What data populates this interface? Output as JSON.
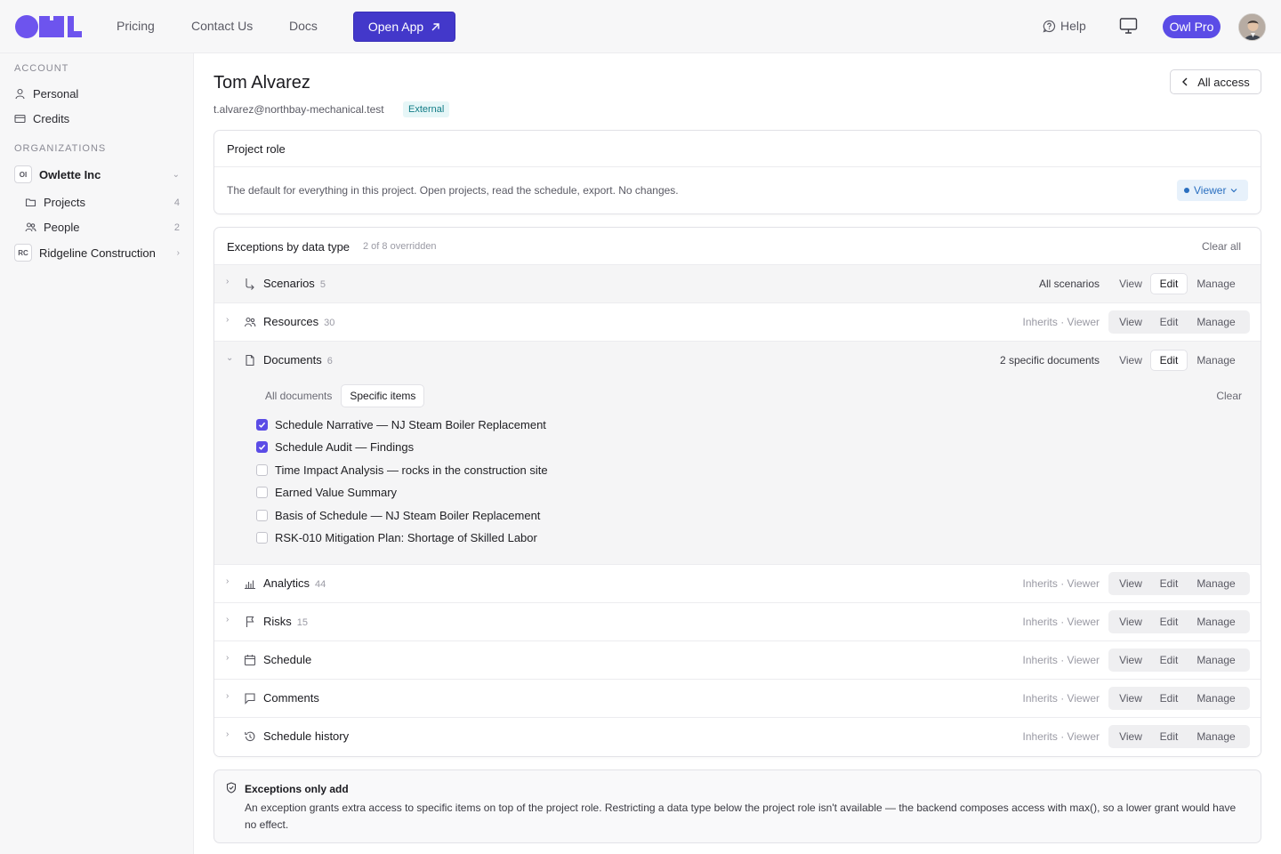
{
  "nav": {
    "links": [
      "Pricing",
      "Contact Us",
      "Docs"
    ],
    "open_app": "Open App",
    "help": "Help",
    "plan": "Owl Pro"
  },
  "sidebar": {
    "account_label": "ACCOUNT",
    "account_items": [
      "Personal",
      "Credits"
    ],
    "orgs_label": "ORGANIZATIONS",
    "org1": {
      "badge": "OI",
      "name": "Owlette Inc"
    },
    "org1_items": [
      {
        "label": "Projects",
        "count": "4"
      },
      {
        "label": "People",
        "count": "2"
      }
    ],
    "org2": {
      "badge": "RC",
      "name": "Ridgeline Construction"
    }
  },
  "user": {
    "name": "Tom Alvarez",
    "email": "t.alvarez@northbay-mechanical.test",
    "badge": "External",
    "back_button": "All access"
  },
  "project_role": {
    "title": "Project role",
    "description": "The default for everything in this project. Open projects, read the schedule, export. No changes.",
    "role": "Viewer"
  },
  "exceptions": {
    "title": "Exceptions by data type",
    "subtitle": "2 of 8 overridden",
    "clear_all": "Clear all",
    "levels": {
      "view": "View",
      "edit": "Edit",
      "manage": "Manage"
    },
    "rows": [
      {
        "label": "Scenarios",
        "count": "5",
        "status": "All scenarios",
        "level": "edit"
      },
      {
        "label": "Resources",
        "count": "30",
        "status": "Inherits · Viewer",
        "level": ""
      },
      {
        "label": "Documents",
        "count": "6",
        "status": "2 specific documents",
        "level": "edit"
      },
      {
        "label": "Analytics",
        "count": "44",
        "status": "Inherits · Viewer",
        "level": ""
      },
      {
        "label": "Risks",
        "count": "15",
        "status": "Inherits · Viewer",
        "level": ""
      },
      {
        "label": "Schedule",
        "count": "",
        "status": "Inherits · Viewer",
        "level": ""
      },
      {
        "label": "Comments",
        "count": "",
        "status": "Inherits · Viewer",
        "level": ""
      },
      {
        "label": "Schedule history",
        "count": "",
        "status": "Inherits · Viewer",
        "level": ""
      }
    ],
    "documents_panel": {
      "tab_all": "All documents",
      "tab_specific": "Specific items",
      "clear": "Clear",
      "items": [
        {
          "label": "Schedule Narrative — NJ Steam Boiler Replacement",
          "checked": true
        },
        {
          "label": "Schedule Audit — Findings",
          "checked": true
        },
        {
          "label": "Time Impact Analysis — rocks in the construction site",
          "checked": false
        },
        {
          "label": "Earned Value Summary",
          "checked": false
        },
        {
          "label": "Basis of Schedule — NJ Steam Boiler Replacement",
          "checked": false
        },
        {
          "label": "RSK-010 Mitigation Plan: Shortage of Skilled Labor",
          "checked": false
        }
      ]
    }
  },
  "note": {
    "title": "Exceptions only add",
    "body": "An exception grants extra access to specific items on top of the project role. Restricting a data type below the project role isn't available — the backend composes access with max(), so a lower grant would have no effect."
  },
  "colors": {
    "brand": "#6d54ee",
    "primary_button": "#4338ca",
    "checkbox": "#5b4ce6",
    "external_badge": "#117c86",
    "viewer_pill": "#2a6fc0"
  }
}
